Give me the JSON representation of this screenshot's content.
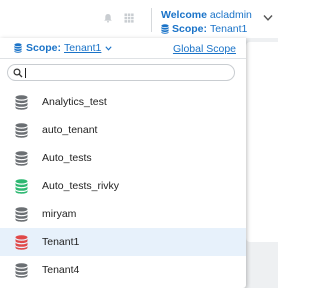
{
  "header": {
    "welcome_prefix": "Welcome",
    "username": "acladmin",
    "scope_label": "Scope:",
    "scope_value": "Tenant1",
    "icons": [
      "bell-icon",
      "grid-icon",
      "chevron-down-icon"
    ]
  },
  "dropdown": {
    "scope_label": "Scope:",
    "scope_value": "Tenant1",
    "global_scope_link": "Global Scope",
    "search": {
      "value": "",
      "placeholder": ""
    },
    "items": [
      {
        "label": "Analytics_test",
        "icon": "database-icon",
        "color": "#6b6f73",
        "selected": false
      },
      {
        "label": "auto_tenant",
        "icon": "database-icon",
        "color": "#6b6f73",
        "selected": false
      },
      {
        "label": "Auto_tests",
        "icon": "database-icon",
        "color": "#6b6f73",
        "selected": false
      },
      {
        "label": "Auto_tests_rivky",
        "icon": "database-icon",
        "color": "#2eb872",
        "selected": false
      },
      {
        "label": "miryam",
        "icon": "database-icon",
        "color": "#6b6f73",
        "selected": false
      },
      {
        "label": "Tenant1",
        "icon": "database-icon",
        "color": "#e04848",
        "selected": true
      },
      {
        "label": "Tenant4",
        "icon": "database-icon",
        "color": "#6b6f73",
        "selected": false
      }
    ]
  },
  "colors": {
    "accent": "#1a73c8",
    "selected_bg": "#e7f1fb",
    "db_default": "#6b6f73",
    "db_green": "#2eb872",
    "db_red": "#e04848"
  }
}
